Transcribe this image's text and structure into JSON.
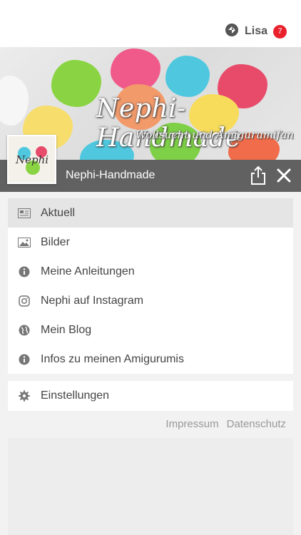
{
  "user": {
    "name": "Lisa",
    "notification_count": "7"
  },
  "banner": {
    "title": "Nephi-Handmade",
    "subtitle": "Wollsucht und Amigurumifan",
    "avatar_text": "Nephi"
  },
  "titlebar": {
    "title": "Nephi-Handmade"
  },
  "menu": {
    "items": [
      {
        "label": "Aktuell",
        "icon": "newspaper-icon"
      },
      {
        "label": "Bilder",
        "icon": "image-icon"
      },
      {
        "label": "Meine Anleitungen",
        "icon": "info-icon"
      },
      {
        "label": "Nephi auf Instagram",
        "icon": "instagram-icon"
      },
      {
        "label": "Mein Blog",
        "icon": "globe-icon"
      },
      {
        "label": "Infos zu meinen Amigurumis",
        "icon": "info-icon"
      }
    ],
    "settings_label": "Einstellungen"
  },
  "footer": {
    "impressum": "Impressum",
    "datenschutz": "Datenschutz"
  },
  "colors": {
    "accent_badge": "#e8212c",
    "titlebar": "#555555",
    "active_item": "#e5e5e5"
  }
}
